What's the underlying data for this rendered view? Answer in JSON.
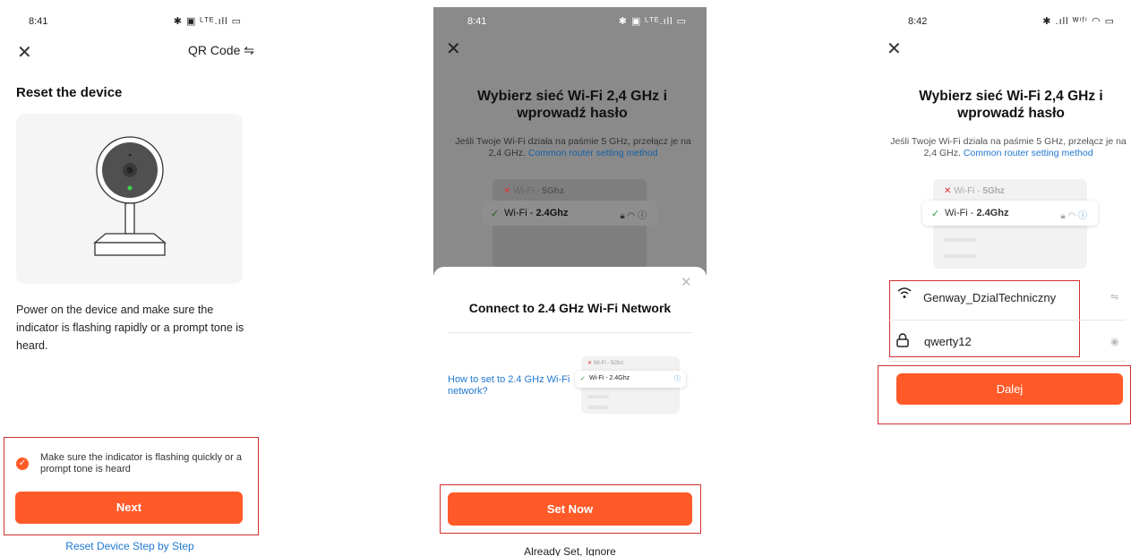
{
  "screen1": {
    "time": "8:41",
    "status_icons": "✱ ▣ ᴸᵀᴱ.ıll ▭",
    "header_right": "QR Code ⇋",
    "title": "Reset the device",
    "description": "Power on the device and make sure the indicator is flashing rapidly or a prompt tone is heard.",
    "checkbox_label": "Make sure the indicator is flashing quickly or a prompt tone is heard",
    "next_label": "Next",
    "reset_link": "Reset Device Step by Step"
  },
  "screen2": {
    "time": "8:41",
    "status_icons": "✱ ▣ ᴸᵀᴱ.ıll ▭",
    "title": "Wybierz sieć Wi-Fi 2,4 GHz i wprowadź hasło",
    "subtitle": "Jeśli Twoje Wi-Fi działa na paśmie 5 GHz, przełącz je na 2,4 GHz.",
    "subtitle_link": "Common router setting method",
    "wifi_5g_prefix": "Wi-Fi - ",
    "wifi_5g": "5Ghz",
    "wifi_24_prefix": "Wi-Fi - ",
    "wifi_24": "2.4Ghz",
    "sheet_title": "Connect to 2.4 GHz Wi-Fi Network",
    "how_link": "How to set to 2.4 GHz Wi-Fi network?",
    "mini_5g": "Wi-Fi - 5Ghz",
    "mini_24": "Wi-Fi - 2.4Ghz",
    "set_now_label": "Set Now",
    "ignore_label": "Already Set, Ignore"
  },
  "screen3": {
    "time": "8:42",
    "status_icons": "✱ .ıll ᵂⁱᶠⁱ ◠ ▭",
    "title": "Wybierz sieć Wi-Fi 2,4 GHz i wprowadź hasło",
    "subtitle": "Jeśli Twoje Wi-Fi działa na paśmie 5 GHz, przełącz je na 2,4 GHz.",
    "subtitle_link": "Common router setting method",
    "wifi_5g_prefix": "Wi-Fi - ",
    "wifi_5g": "5Ghz",
    "wifi_24_prefix": "Wi-Fi - ",
    "wifi_24": "2.4Ghz",
    "ssid_value": "Genway_DzialTechniczny",
    "password_value": "qwerty12",
    "next_label": "Dalej"
  },
  "colors": {
    "accent": "#ff5a28",
    "link": "#1f78d1",
    "highlight": "#d32f2f"
  }
}
